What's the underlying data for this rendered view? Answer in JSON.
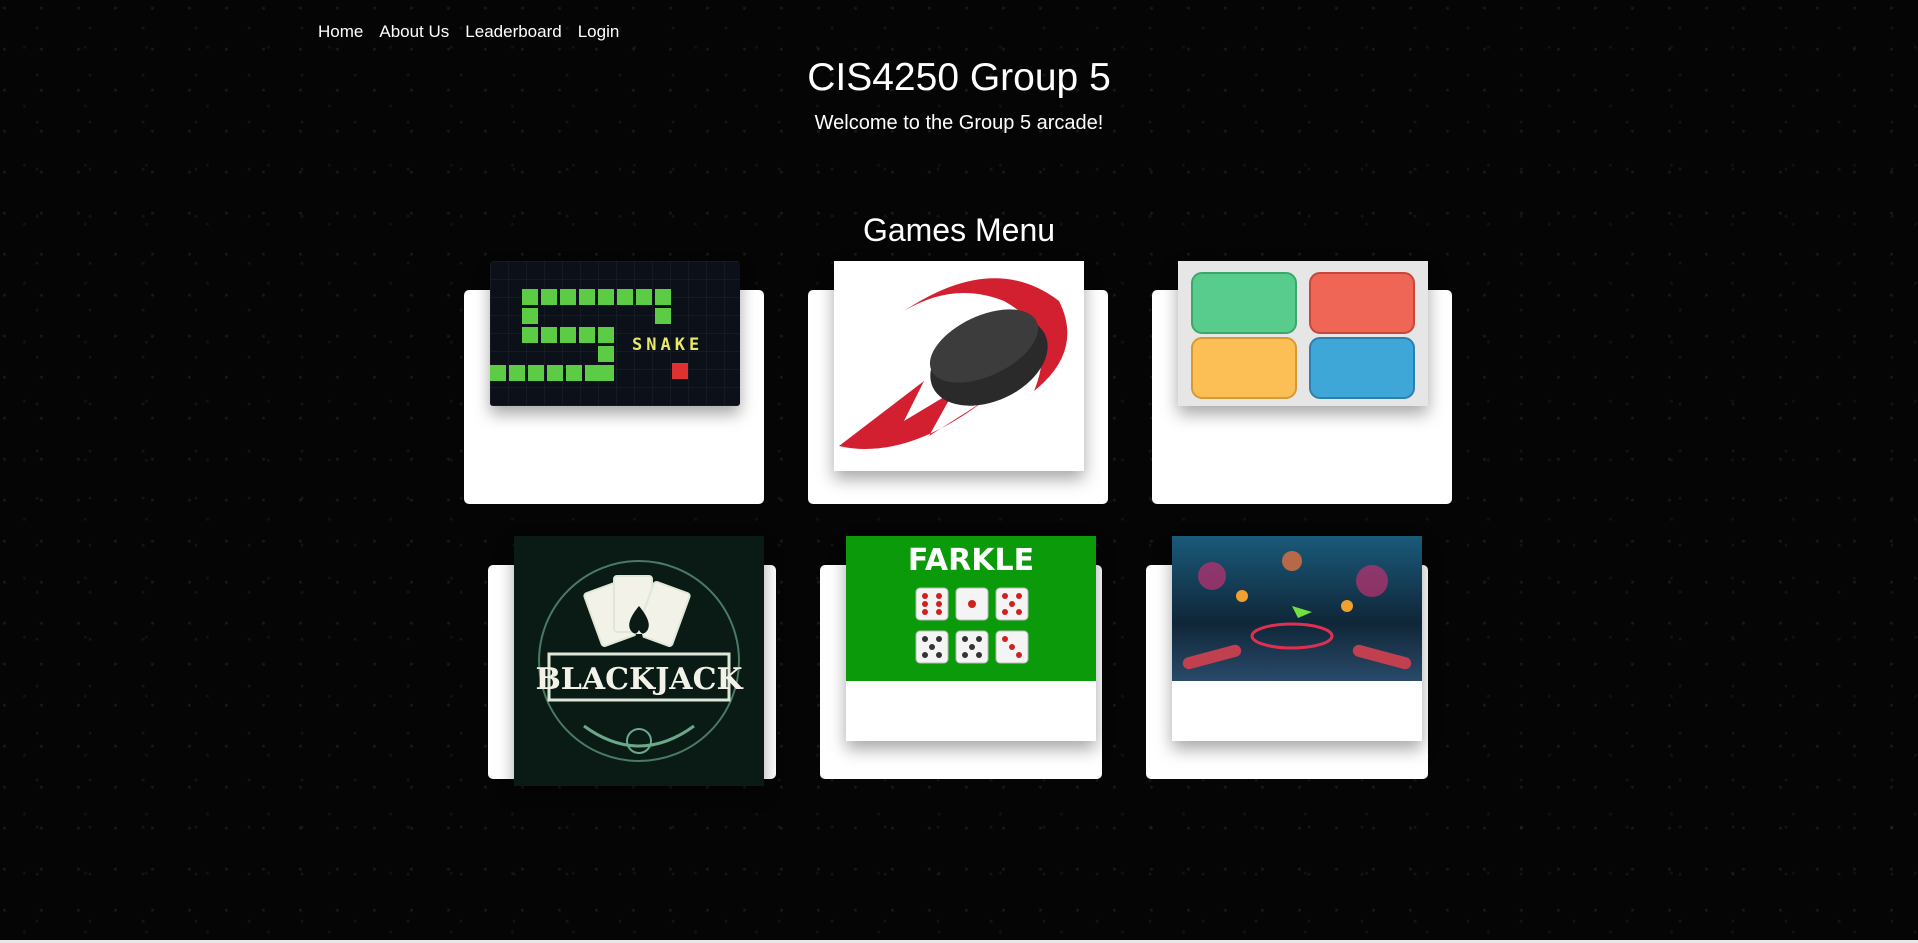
{
  "nav": {
    "items": [
      {
        "label": "Home"
      },
      {
        "label": "About Us"
      },
      {
        "label": "Leaderboard"
      },
      {
        "label": "Login"
      }
    ]
  },
  "header": {
    "title": "CIS4250 Group 5",
    "subtitle": "Welcome to the Group 5 arcade!"
  },
  "games_menu": {
    "heading": "Games Menu",
    "games": [
      {
        "image_icon": "snake-icon",
        "image_text": "SNAKE"
      },
      {
        "image_icon": "hockey-puck-icon"
      },
      {
        "image_icon": "color-memory-icon"
      },
      {
        "image_icon": "blackjack-icon",
        "image_text": "BLACKJACK"
      },
      {
        "image_icon": "farkle-dice-icon",
        "image_text": "FARKLE"
      },
      {
        "image_icon": "pinball-icon"
      }
    ]
  },
  "colors": {
    "background": "#050505",
    "card": "#ffffff",
    "snake_green": "#5ccc45",
    "puck_red": "#d32030",
    "farkle_green": "#0a9a0a"
  }
}
